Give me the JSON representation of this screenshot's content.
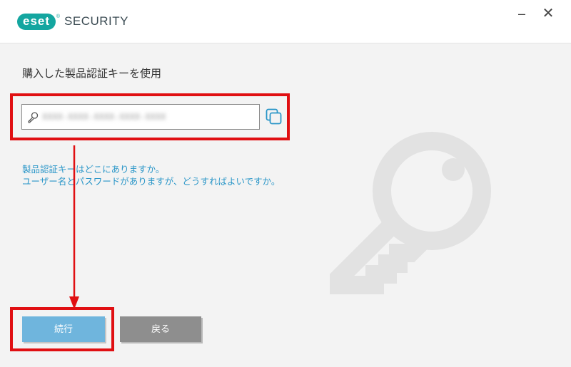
{
  "window": {
    "brand_logo": "eset",
    "title": "SECURITY",
    "minimize_label": "–",
    "close_label": "✕"
  },
  "form": {
    "heading": "購入した製品認証キーを使用",
    "license_key_value": "XXXX-XXXX-XXXX-XXXX-XXXX",
    "key_field_icon": "key-icon",
    "paste_icon": "paste-icon"
  },
  "links": {
    "find_key": "製品認証キーはどこにありますか。",
    "have_credentials": "ユーザー名とパスワードがありますが、どうすればよいですか。"
  },
  "buttons": {
    "continue": "続行",
    "back": "戻る"
  },
  "colors": {
    "brand": "#14a6a0",
    "link": "#2a96c8",
    "primary_button": "#6fb5dd",
    "secondary_button": "#8e8e8e",
    "highlight": "#e00f12"
  }
}
